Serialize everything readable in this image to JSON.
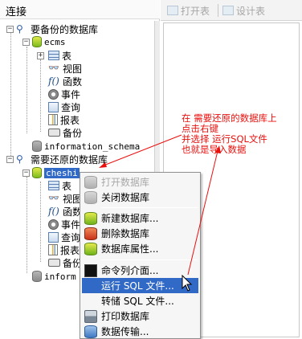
{
  "header": {
    "title": "连接"
  },
  "toolbar": {
    "open_table": "打开表",
    "design_table": "设计表"
  },
  "tree": {
    "conn1": "要备份的数据库",
    "db_ecms": "ecms",
    "table": "表",
    "view": "视图",
    "function": "函数",
    "event": "事件",
    "query": "查询",
    "report": "报表",
    "backup": "备份",
    "info_schema": "information_schema",
    "conn2": "需要还原的数据库",
    "db_cheshi": "cheshi",
    "table2": "表",
    "view2": "视图",
    "function2": "函数",
    "event2": "事件",
    "query2": "查询",
    "report2": "报表",
    "backup2": "备份",
    "info2_partial": "inform"
  },
  "menu": {
    "open_db": "打开数据库",
    "close_db": "关闭数据库",
    "new_db": "新建数据库...",
    "delete_db": "删除数据库",
    "db_props": "数据库属性...",
    "console": "命令列介面...",
    "run_sql": "运行 SQL 文件...",
    "dump_sql": "转储 SQL 文件...",
    "print_db": "打印数据库",
    "transfer": "数据传输..."
  },
  "annotation": {
    "line1": "在 需要还原的数据库上",
    "line2": "点击右键",
    "line3": "并选择 运行SQL文件",
    "line4": "也就是导入数据"
  },
  "colors": {
    "selection": "#3169c6",
    "annotation": "#e8110e"
  }
}
